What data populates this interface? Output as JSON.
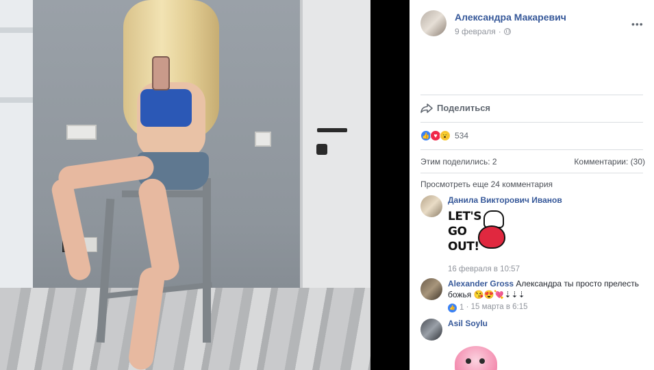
{
  "post": {
    "author": "Александра Макаревич",
    "date": "9 февраля",
    "date_sep": "·",
    "more_icon": "ellipsis-icon",
    "share_label": "Поделиться",
    "reactions": {
      "types": [
        "like",
        "love",
        "wow"
      ],
      "count": "534"
    },
    "shares_text": "Этим поделились: 2",
    "comments_text": "Комментарии: (30)"
  },
  "comments_section": {
    "view_more": "Просмотреть еще 24 комментария",
    "items": [
      {
        "name": "Данила Викторович Иванов",
        "text": "",
        "sticker": "LET'S GO OUT! sticker",
        "sticker_text": "LET'S\nGO\nOUT!",
        "time": "16 февраля в 10:57"
      },
      {
        "name": "Alexander Gross",
        "text": "Александра ты просто прелесть божья",
        "emoji": "😘😍💘⇣⇣⇣",
        "likes": "1",
        "time": "15 марта в 6:15",
        "meta_sep": "·"
      },
      {
        "name": "Asil Soylu",
        "sticker": "pink bird sticker"
      }
    ]
  },
  "colors": {
    "link": "#365899",
    "muted": "#90949c",
    "like": "#3b82f5",
    "love": "#f0284a",
    "wow": "#f7c933"
  }
}
